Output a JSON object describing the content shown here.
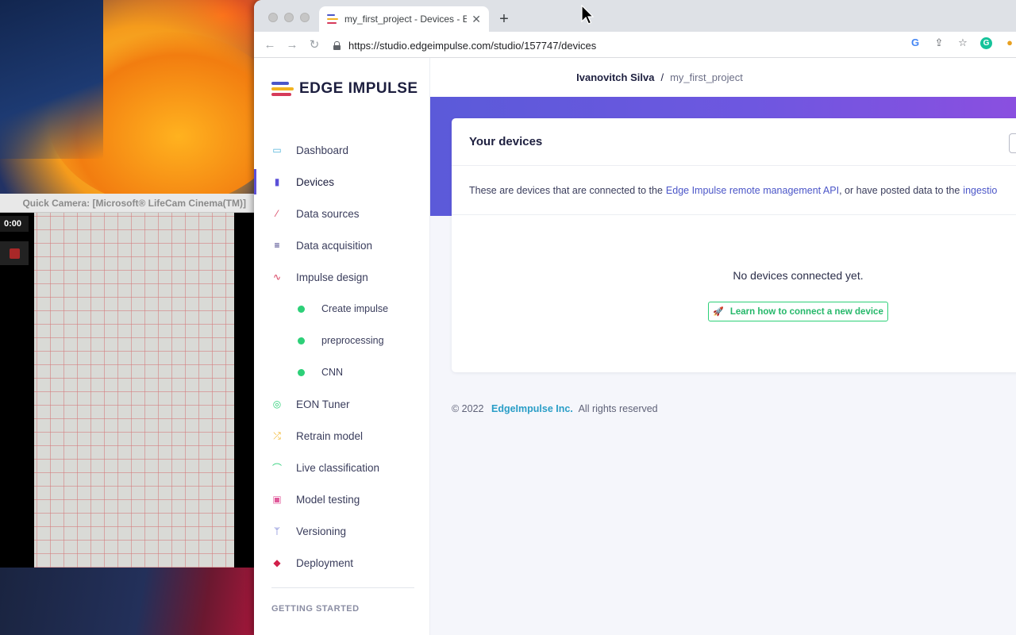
{
  "quick_camera": {
    "title": "Quick Camera: [Microsoft® LifeCam Cinema(TM)]",
    "timer": "0:00"
  },
  "browser": {
    "tab_title": "my_first_project - Devices - Ed",
    "url": "https://studio.edgeimpulse.com/studio/157747/devices"
  },
  "app": {
    "logo_text": "EDGE IMPULSE",
    "breadcrumb": {
      "user": "Ivanovitch Silva",
      "separator": "/",
      "project": "my_first_project"
    }
  },
  "sidebar": {
    "items": [
      {
        "label": "Dashboard",
        "icon": "monitor-icon",
        "color": "#4fb3d9"
      },
      {
        "label": "Devices",
        "icon": "chip-icon",
        "color": "#5b50d8",
        "active": true
      },
      {
        "label": "Data sources",
        "icon": "wand-icon",
        "color": "#d63a5a"
      },
      {
        "label": "Data acquisition",
        "icon": "database-icon",
        "color": "#2f2a7a"
      },
      {
        "label": "Impulse design",
        "icon": "pulse-icon",
        "color": "#d63a5a"
      },
      {
        "label": "Create impulse",
        "sub": true
      },
      {
        "label": "preprocessing",
        "sub": true
      },
      {
        "label": "CNN",
        "sub": true
      },
      {
        "label": "EON Tuner",
        "icon": "compass-icon",
        "color": "#2dd078"
      },
      {
        "label": "Retrain model",
        "icon": "shuffle-icon",
        "color": "#f2b321"
      },
      {
        "label": "Live classification",
        "icon": "curve-icon",
        "color": "#2dd078"
      },
      {
        "label": "Model testing",
        "icon": "clipboard-icon",
        "color": "#e05a9a"
      },
      {
        "label": "Versioning",
        "icon": "branch-icon",
        "color": "#4b56c8"
      },
      {
        "label": "Deployment",
        "icon": "box-icon",
        "color": "#d1204a"
      }
    ],
    "section_label": "GETTING STARTED"
  },
  "devices_card": {
    "title": "Your devices",
    "desc_prefix": "These are devices that are connected to the ",
    "desc_link": "Edge Impulse remote management API",
    "desc_middle": ", or have posted data to the ",
    "desc_link2": "ingestio",
    "empty_message": "No devices connected yet.",
    "learn_button": "Learn how to connect a new device"
  },
  "footer": {
    "copyright": "© 2022",
    "company": "EdgeImpulse Inc.",
    "rights": "All rights reserved"
  }
}
